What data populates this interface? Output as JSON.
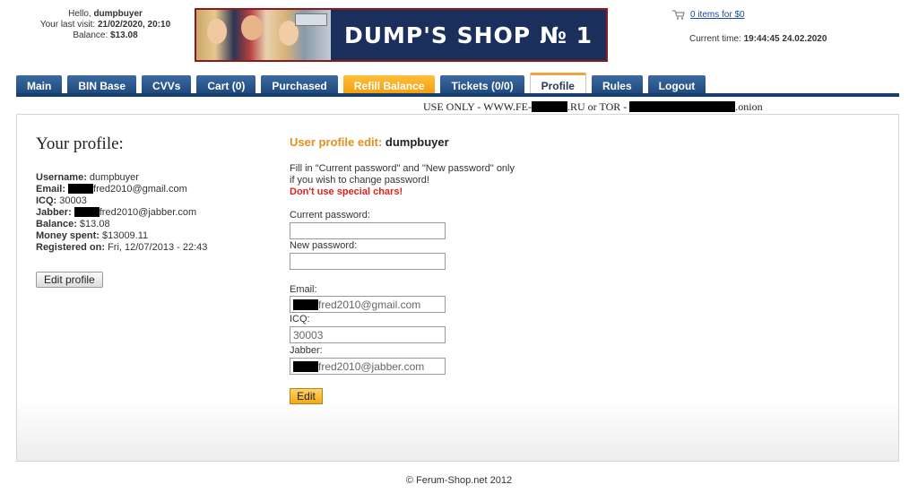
{
  "header": {
    "hello_prefix": "Hello, ",
    "username": "dumpbuyer",
    "last_visit_label": "Your last visit: ",
    "last_visit": "21/02/2020, 20:10",
    "balance_label": "Balance: ",
    "balance": "$13.08",
    "banner_title": "DUMP'S SHOP № 1",
    "cart_link": "0 items for $0",
    "time_label": "Current time: ",
    "time_value": "19:44:45 24.02.2020"
  },
  "nav": {
    "tabs": [
      {
        "label": "Main",
        "state": "normal"
      },
      {
        "label": "BIN Base",
        "state": "normal"
      },
      {
        "label": "CVVs",
        "state": "normal"
      },
      {
        "label": "Cart (0)",
        "state": "normal"
      },
      {
        "label": "Purchased",
        "state": "normal"
      },
      {
        "label": "Refill Balance",
        "state": "highlight"
      },
      {
        "label": "Tickets (0/0)",
        "state": "normal"
      },
      {
        "label": "Profile",
        "state": "active"
      },
      {
        "label": "Rules",
        "state": "normal"
      },
      {
        "label": "Logout",
        "state": "normal"
      }
    ]
  },
  "notice": {
    "part1": "USE ONLY - WWW.FE-",
    "part2": ".RU or TOR -",
    "part3": ".onion"
  },
  "profile": {
    "title": "Your profile:",
    "username_label": "Username:",
    "username": "dumpbuyer",
    "email_label": "Email:",
    "email": "fred2010@gmail.com",
    "icq_label": "ICQ:",
    "icq": "30003",
    "jabber_label": "Jabber:",
    "jabber": "fred2010@jabber.com",
    "balance_label": "Balance:",
    "balance": "$13.08",
    "spent_label": "Money spent:",
    "spent": "$13009.11",
    "registered_label": "Registered on:",
    "registered": "Fri, 12/07/2013 - 22:43",
    "edit_button": "Edit profile"
  },
  "edit_form": {
    "title": "User profile edit:",
    "username": "dumpbuyer",
    "hint_line1": "Fill in \"Current password\" and \"New password\" only",
    "hint_line2": "if you wish to change password!",
    "warning": "Don't use special chars!",
    "current_password_label": "Current password:",
    "current_password_value": "",
    "new_password_label": "New password:",
    "new_password_value": "",
    "email_label": "Email:",
    "email_value": "fred2010@gmail.com",
    "icq_label": "ICQ:",
    "icq_value": "30003",
    "jabber_label": "Jabber:",
    "jabber_value": "fred2010@jabber.com",
    "submit": "Edit"
  },
  "footer": {
    "text": "© Ferum-Shop.net 2012"
  },
  "colors": {
    "nav_blue": "#1d4579",
    "nav_orange": "#f39a0a",
    "accent_orange": "#e09020",
    "warning_red": "#e02020",
    "banner_navy": "#1b2f5d",
    "link_blue": "#1a4a9c"
  }
}
